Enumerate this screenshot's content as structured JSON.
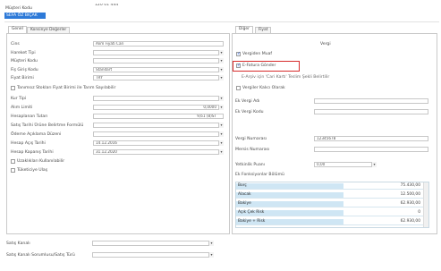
{
  "header": {
    "code_label": "Müşteri Kodu",
    "code_value": "120 01 444",
    "name_value": "SEFA ÖZ BIÇAK"
  },
  "left_tabs": [
    "Genel",
    "Konsinye Değerler"
  ],
  "left_fields": [
    {
      "label": "Cins",
      "value": "Alım Fiyatı Cari",
      "dropdown": false
    },
    {
      "label": "Hareket Tipi",
      "value": "",
      "dropdown": true
    },
    {
      "label": "Müşteri Kodu",
      "value": "",
      "dropdown": true
    },
    {
      "label": "Fiş Giriş Kodu",
      "value": "Standart",
      "dropdown": true
    },
    {
      "label": "Fiyat Birimi",
      "value": "TRY",
      "dropdown": true
    }
  ],
  "left_checkbox_1": "Tanımsız Stokları Fiyat Birimi ile Tarım Sayılabilir",
  "left_fields_2": [
    {
      "label": "Kur Tipi",
      "value": "",
      "dropdown": true
    },
    {
      "label": "Alım Limiti",
      "value": "0,0000",
      "dropdown": true
    },
    {
      "label": "Hesaplanan Tutarı",
      "value": "9,61 (8)ST",
      "dropdown": false
    },
    {
      "label": "Satış Tarihi Ürüne Belirtme Formülü",
      "value": "",
      "dropdown": true
    },
    {
      "label": "Ödeme Açıklama Düzeni",
      "value": "",
      "dropdown": true
    },
    {
      "label": "Hesap Açış Tarihi",
      "value": "14.12.2016",
      "dropdown": true
    },
    {
      "label": "Hesap Kapanış Tarihi",
      "value": "31.12.2020",
      "dropdown": true
    }
  ],
  "left_checkboxes": [
    "Uzaklıkları Kullanılabilir",
    "Tüketiciye Ulaş"
  ],
  "bottom_fields": [
    {
      "label": "Satış Kanalı",
      "value": ""
    },
    {
      "label": "Satış Kanalı Sorumlusu/Satış Türü",
      "value": ""
    }
  ],
  "right_tabs": [
    "Diğer",
    "Fiyat"
  ],
  "right": {
    "section_title": "Vergi",
    "cb_tevkifat": "Vergiden Muaf",
    "cb_highlight": "E-Fatura Gönder",
    "info_line": "E-Arşiv için 'Cari Kartı' Teslim Şekli Belirtilir",
    "cb_manual": "Vergiler Kalıcı Olarak",
    "f1_label": "Ek Vergi Adı",
    "f2_label": "Ek Vergi Kodu",
    "f3_label": "Vergi Numarası",
    "f3_value": "12345678",
    "f4_label": "Mersis Numarası",
    "f5_label": "Yetkinlik Puanı",
    "f5_value": "0,00",
    "grid_caption": "Ek Fonksiyonlar Bölümü"
  },
  "grid_rows": [
    {
      "name": "Borç",
      "value": "75.430,00"
    },
    {
      "name": "Alacak",
      "value": "12.500,00"
    },
    {
      "name": "Bakiye",
      "value": "62.930,00"
    },
    {
      "name": "Açık Çek Risk",
      "value": "0"
    },
    {
      "name": "Bakiye + Risk",
      "value": "62.930,00"
    }
  ],
  "colors": {
    "selection_bg": "#2e7ad8",
    "highlight_border": "#d62b2b",
    "grid_name_bg": "#cfe6f4"
  }
}
